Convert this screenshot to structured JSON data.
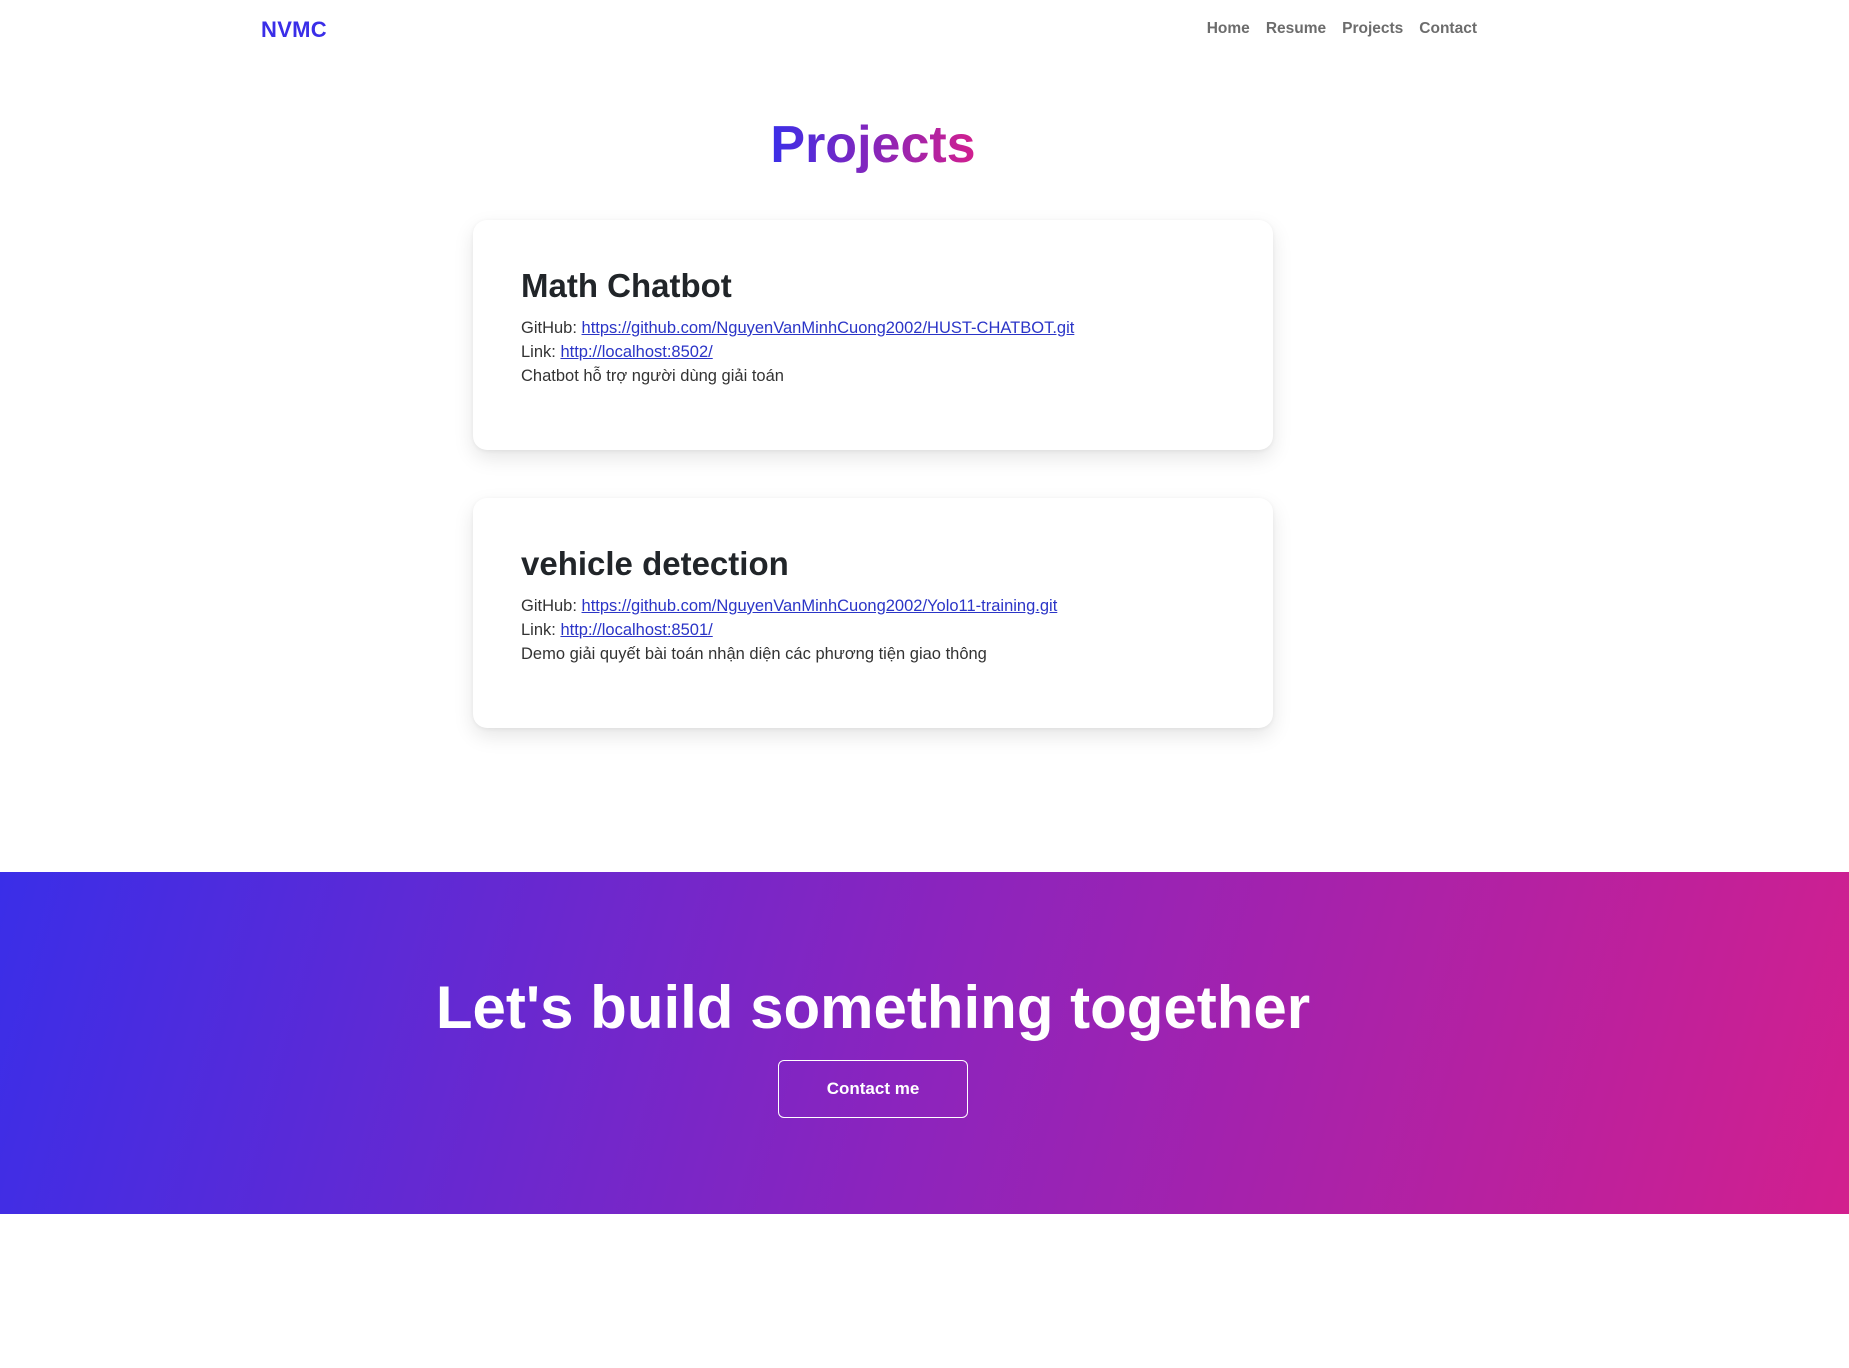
{
  "nav": {
    "brand": "NVMC",
    "links": [
      {
        "label": "Home"
      },
      {
        "label": "Resume"
      },
      {
        "label": "Projects"
      },
      {
        "label": "Contact"
      }
    ]
  },
  "projects": {
    "title": "Projects",
    "items": [
      {
        "title": "Math Chatbot",
        "github_label": "GitHub:",
        "github_url": "https://github.com/NguyenVanMinhCuong2002/HUST-CHATBOT.git",
        "link_label": "Link:",
        "link_url": "http://localhost:8502/",
        "description": "Chatbot hỗ trợ người dùng giải toán"
      },
      {
        "title": "vehicle detection",
        "github_label": "GitHub:",
        "github_url": "https://github.com/NguyenVanMinhCuong2002/Yolo11-training.git",
        "link_label": "Link:",
        "link_url": "http://localhost:8501/",
        "description": "Demo giải quyết bài toán nhận diện các phương tiện giao thông"
      }
    ]
  },
  "cta": {
    "title": "Let's build something together",
    "button_label": "Contact me"
  },
  "colors": {
    "brand": "#3a2ee8",
    "gradient_start": "#3a2ee8",
    "gradient_end": "#d21f8e",
    "link": "#2b35c7",
    "nav_text": "#6c6c6c"
  }
}
